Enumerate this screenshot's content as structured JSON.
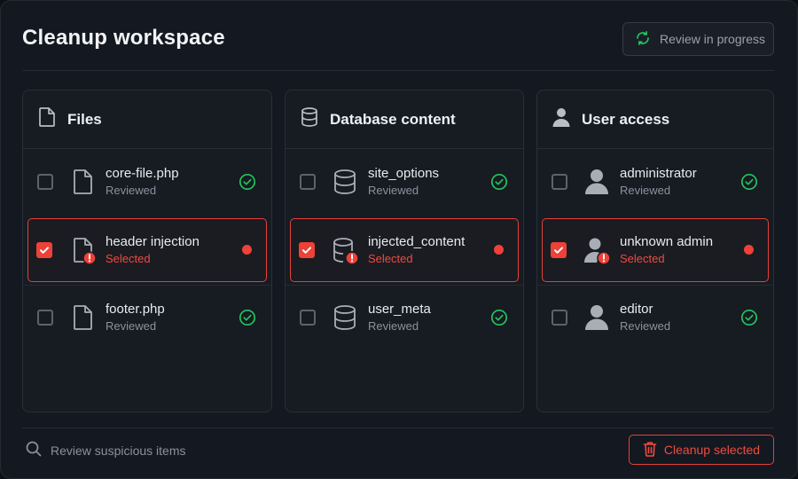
{
  "header": {
    "title": "Cleanup workspace",
    "status_label": "Review in progress",
    "status_icon": "refresh-icon"
  },
  "colors": {
    "accent_red": "#ef4137",
    "success_green": "#22c55e",
    "background": "#141820"
  },
  "panels": [
    {
      "title": "Files",
      "icon": "file-icon",
      "items": [
        {
          "name": "core-file.php",
          "status": "Reviewed",
          "checked": false,
          "state": "reviewed"
        },
        {
          "name": "header injection",
          "status": "Selected",
          "checked": true,
          "state": "selected"
        },
        {
          "name": "footer.php",
          "status": "Reviewed",
          "checked": false,
          "state": "reviewed"
        }
      ]
    },
    {
      "title": "Database content",
      "icon": "database-icon",
      "items": [
        {
          "name": "site_options",
          "status": "Reviewed",
          "checked": false,
          "state": "reviewed"
        },
        {
          "name": "injected_content",
          "status": "Selected",
          "checked": true,
          "state": "selected"
        },
        {
          "name": "user_meta",
          "status": "Reviewed",
          "checked": false,
          "state": "reviewed"
        }
      ]
    },
    {
      "title": "User access",
      "icon": "user-icon",
      "items": [
        {
          "name": "administrator",
          "status": "Reviewed",
          "checked": false,
          "state": "reviewed"
        },
        {
          "name": "unknown admin",
          "status": "Selected",
          "checked": true,
          "state": "selected"
        },
        {
          "name": "editor",
          "status": "Reviewed",
          "checked": false,
          "state": "reviewed"
        }
      ]
    }
  ],
  "footer": {
    "search_placeholder": "Review suspicious items",
    "cleanup_label": "Cleanup selected"
  }
}
